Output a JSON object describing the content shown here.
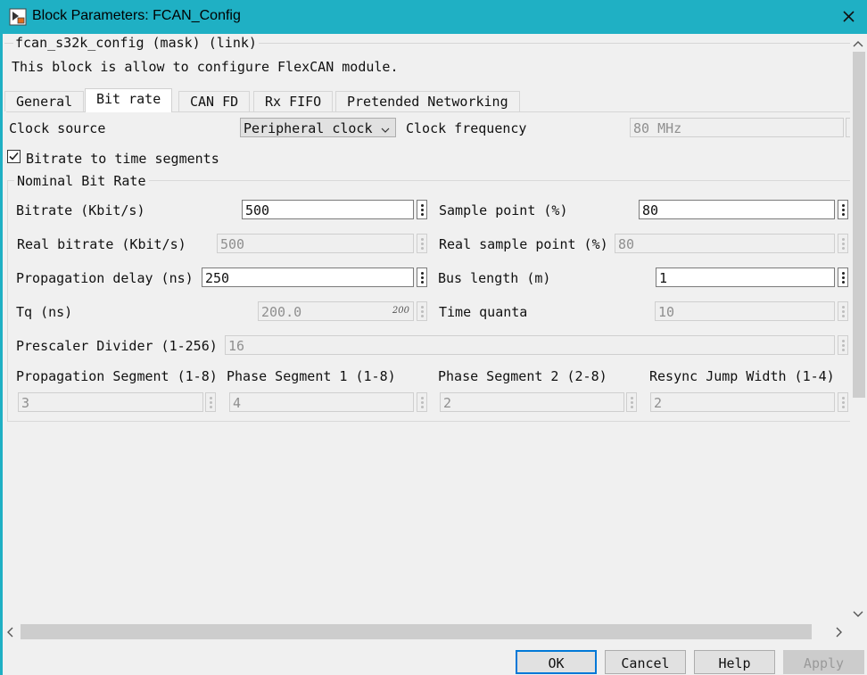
{
  "window": {
    "title": "Block Parameters: FCAN_Config",
    "close_glyph": "✕",
    "accent_color": "#1fb0c4"
  },
  "header": {
    "mask_line": "fcan_s32k_config (mask) (link)",
    "description": "This block is allow to configure FlexCAN module."
  },
  "tabs": [
    {
      "label": "General",
      "active": false
    },
    {
      "label": "Bit rate",
      "active": true
    },
    {
      "label": "CAN FD",
      "active": false
    },
    {
      "label": "Rx FIFO",
      "active": false
    },
    {
      "label": "Pretended Networking",
      "active": false
    }
  ],
  "clock": {
    "source_label": "Clock source",
    "source_value": "Peripheral clock",
    "frequency_label": "Clock frequency",
    "frequency_value": "80 MHz"
  },
  "bitrate_to_segments": {
    "label": "Bitrate to time segments",
    "checked": true
  },
  "nominal": {
    "group_title": "Nominal Bit Rate",
    "bitrate_label": "Bitrate (Kbit/s)",
    "bitrate_value": "500",
    "sample_point_label": "Sample point (%)",
    "sample_point_value": "80",
    "real_bitrate_label": "Real bitrate (Kbit/s)",
    "real_bitrate_value": "500",
    "real_sample_point_label": "Real sample point (%)",
    "real_sample_point_value": "80",
    "prop_delay_label": "Propagation delay (ns)",
    "prop_delay_value": "250",
    "bus_length_label": "Bus length (m)",
    "bus_length_value": "1",
    "tq_label": "Tq (ns)",
    "tq_value": "200.0",
    "tq_hint": "200",
    "time_quanta_label": "Time quanta",
    "time_quanta_value": "10",
    "prescaler_label": "Prescaler Divider (1-256)",
    "prescaler_value": "16",
    "prop_seg_label": "Propagation Segment (1-8)",
    "prop_seg_value": "3",
    "phase1_label": "Phase Segment 1 (1-8)",
    "phase1_value": "4",
    "phase2_label": "Phase Segment 2 (2-8)",
    "phase2_value": "2",
    "sjw_label": "Resync Jump Width (1-4)",
    "sjw_value": "2"
  },
  "buttons": {
    "ok": "OK",
    "cancel": "Cancel",
    "help": "Help",
    "apply": "Apply"
  }
}
